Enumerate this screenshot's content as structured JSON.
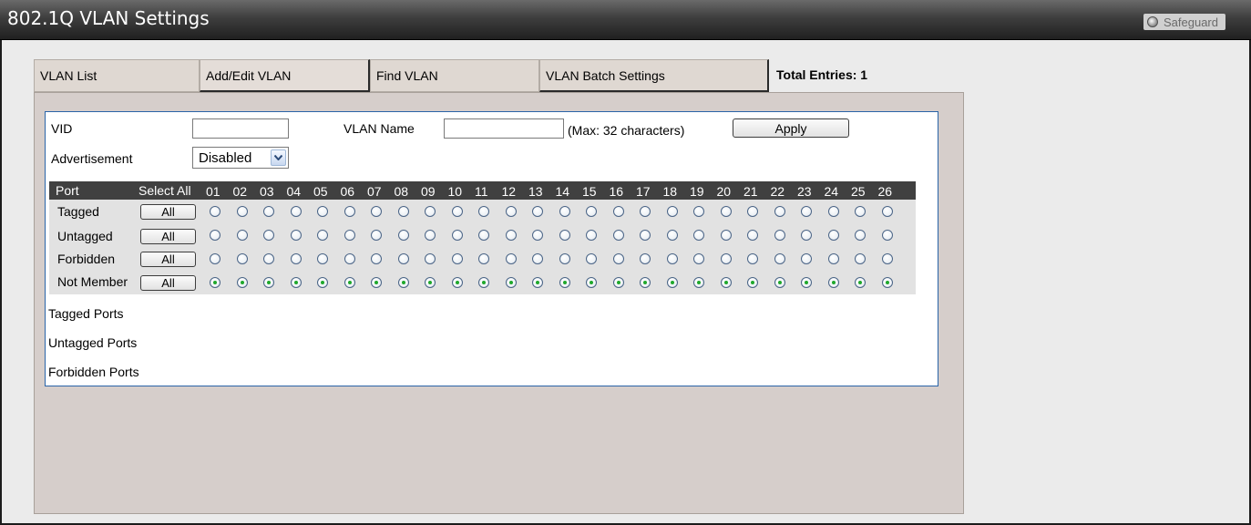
{
  "window": {
    "title": "802.1Q VLAN Settings",
    "safeguard_label": "Safeguard"
  },
  "tabs": [
    {
      "label": "VLAN List"
    },
    {
      "label": "Add/Edit VLAN"
    },
    {
      "label": "Find VLAN"
    },
    {
      "label": "VLAN Batch Settings"
    }
  ],
  "total_entries": "Total Entries: 1",
  "form": {
    "vid_label": "VID",
    "vid_value": "",
    "vlan_name_label": "VLAN Name",
    "vlan_name_value": "",
    "max_hint": "(Max: 32 characters)",
    "apply_label": "Apply",
    "advertisement_label": "Advertisement",
    "advertisement_value": "Disabled"
  },
  "port_table": {
    "header_port": "Port",
    "header_select_all": "Select All",
    "ports": [
      "01",
      "02",
      "03",
      "04",
      "05",
      "06",
      "07",
      "08",
      "09",
      "10",
      "11",
      "12",
      "13",
      "14",
      "15",
      "16",
      "17",
      "18",
      "19",
      "20",
      "21",
      "22",
      "23",
      "24",
      "25",
      "26"
    ],
    "rows": [
      {
        "label": "Tagged",
        "all_label": "All",
        "selected": false
      },
      {
        "label": "Untagged",
        "all_label": "All",
        "selected": false
      },
      {
        "label": "Forbidden",
        "all_label": "All",
        "selected": false
      },
      {
        "label": "Not Member",
        "all_label": "All",
        "selected": true
      }
    ]
  },
  "summary": {
    "tagged_ports": "Tagged Ports",
    "untagged_ports": "Untagged Ports",
    "forbidden_ports": "Forbidden Ports"
  },
  "colors": {
    "header_bg": "#404040",
    "panel_bg": "#d6cecb",
    "inner_border": "#2a64a8",
    "radio_selected": "#1fa82c"
  }
}
